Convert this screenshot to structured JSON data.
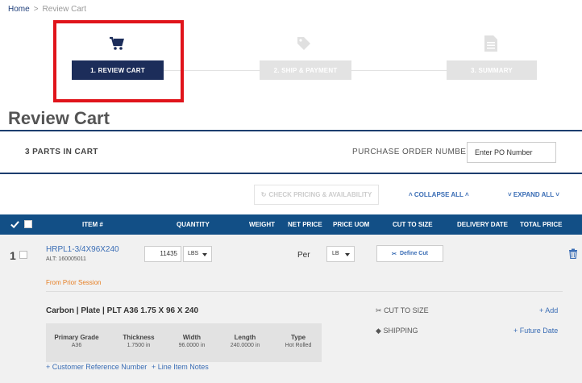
{
  "breadcrumb": {
    "home": "Home",
    "separator": ">",
    "current": "Review Cart"
  },
  "steps": [
    {
      "label": "1. REVIEW CART",
      "icon": "cart-icon",
      "active": true
    },
    {
      "label": "2. SHIP & PAYMENT",
      "icon": "tag-icon",
      "active": false
    },
    {
      "label": "3. SUMMARY",
      "icon": "document-icon",
      "active": false
    }
  ],
  "page_title": "Review Cart",
  "cart": {
    "parts_count": "3 PARTS IN CART",
    "po_label": "PURCHASE ORDER NUMBER",
    "po_placeholder": "Enter PO Number"
  },
  "actions": {
    "check_pricing": "CHECK PRICING & AVAILABILITY",
    "collapse_all": "COLLAPSE ALL",
    "expand_all": "EXPAND ALL"
  },
  "table": {
    "headers": [
      "ITEM #",
      "QUANTITY",
      "WEIGHT",
      "NET PRICE",
      "PRICE UOM",
      "CUT TO SIZE",
      "DELIVERY DATE",
      "TOTAL PRICE"
    ]
  },
  "row": {
    "number": "1",
    "part_number": "HRPL1-3/4X96X240",
    "alt": "ALT: 160005011",
    "quantity": "11435",
    "quantity_uom": "LBS",
    "net_price": "Per",
    "price_uom": "LB",
    "define_cut": "Define Cut",
    "session_note": "From Prior Session",
    "description": "Carbon | Plate |  PLT A36 1.75 X 96 X 240",
    "cut_to_size": "CUT TO SIZE",
    "add": "+ Add",
    "shipping": "SHIPPING",
    "future_date": "+ Future Date",
    "specs": [
      {
        "label": "Primary Grade",
        "value": "A36"
      },
      {
        "label": "Thickness",
        "value": "1.7500 in"
      },
      {
        "label": "Width",
        "value": "96.0000 in"
      },
      {
        "label": "Length",
        "value": "240.0000 in"
      },
      {
        "label": "Type",
        "value": "Hot Rolled"
      }
    ],
    "customer_reference": "+ Customer Reference Number",
    "line_item_notes": "+ Line Item Notes"
  },
  "colors": {
    "navy": "#1c2d5a",
    "header_blue": "#124f86",
    "link_blue": "#3a6db5",
    "highlight_red": "#e0141b",
    "orange": "#e67e22"
  }
}
